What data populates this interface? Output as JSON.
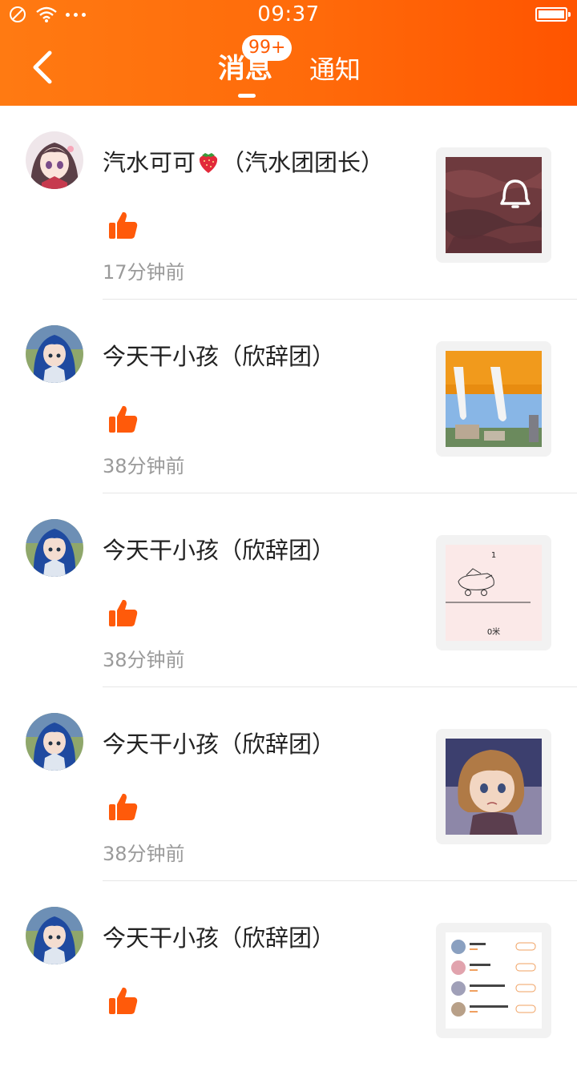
{
  "status_bar": {
    "time": "09:37"
  },
  "header": {
    "tabs": [
      {
        "label": "消息",
        "active": true,
        "badge": "99+"
      },
      {
        "label": "通知",
        "active": false
      }
    ]
  },
  "colors": {
    "header_start": "#ff7a12",
    "header_end": "#ff5400",
    "like": "#ff5a0a",
    "time_text": "#9a9a9a"
  },
  "items": [
    {
      "name_before": "汽水可可",
      "name_icon": "strawberry-emoji",
      "name_after": "（汽水团团长）",
      "time": "17分钟前",
      "reaction": "thumbs-up-icon",
      "thumb": "bell-picture"
    },
    {
      "name": "今天干小孩（欣辞团）",
      "time": "38分钟前",
      "reaction": "thumbs-up-icon",
      "thumb": "game-scene-picture"
    },
    {
      "name": "今天干小孩（欣辞团）",
      "time": "38分钟前",
      "reaction": "thumbs-up-icon",
      "thumb": "sketch-picture",
      "thumb_text": {
        "top": "1",
        "bottom": "0米"
      }
    },
    {
      "name": "今天干小孩（欣辞团）",
      "time": "38分钟前",
      "reaction": "thumbs-up-icon",
      "thumb": "anime-face-picture"
    },
    {
      "name": "今天干小孩（欣辞团）",
      "time": "",
      "reaction": "thumbs-up-icon",
      "thumb": "user-list-picture"
    }
  ]
}
